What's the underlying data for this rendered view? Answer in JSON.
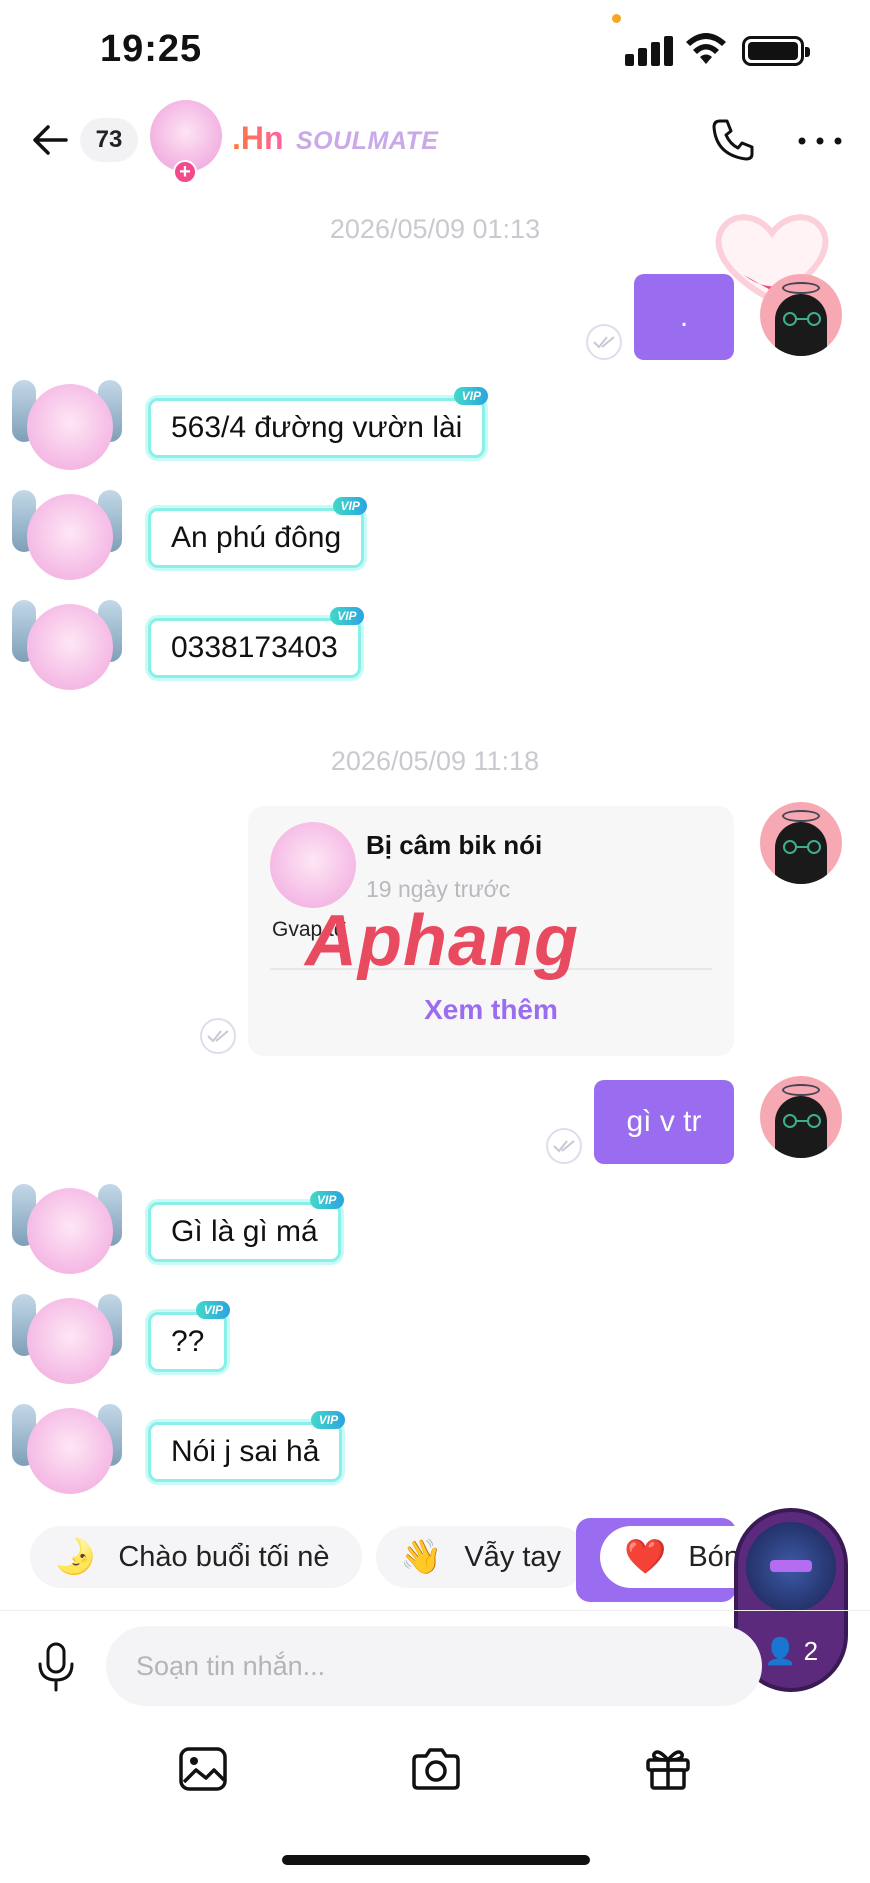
{
  "status_bar": {
    "time": "19:25"
  },
  "header": {
    "unread_count": "73",
    "peer_name": ".Hn",
    "peer_tag": "SOULMATE"
  },
  "chat": {
    "timestamp_1": "2026/05/09 01:13",
    "timestamp_2": "2026/05/09 11:18",
    "out_msg_1": ".",
    "in_msgs_1": [
      "563/4 đường vườn lài",
      "An phú đông",
      "0338173403"
    ],
    "vip_label": "VIP",
    "card": {
      "title": "Bị câm bik nói",
      "subtitle": "19 ngày trước",
      "body": "Gvap tđ",
      "action": "Xem thêm"
    },
    "out_msg_2": "gì v tr",
    "in_msgs_2": [
      "Gì là gì má",
      "??",
      "Nói j sai hả"
    ]
  },
  "watermark": "Aphang",
  "quick_replies": [
    {
      "emoji": "🌛",
      "label": "Chào buổi tối nè"
    },
    {
      "emoji": "👋",
      "label": "Vẫy tay"
    },
    {
      "emoji": "❤️",
      "label": "Bón"
    }
  ],
  "floating_room": {
    "count": "2"
  },
  "composer": {
    "placeholder": "Soạn tin nhắn..."
  },
  "colors": {
    "accent": "#9a6cf0",
    "bubble_border": "#88f0e8",
    "vip": "#2aa4e0"
  }
}
